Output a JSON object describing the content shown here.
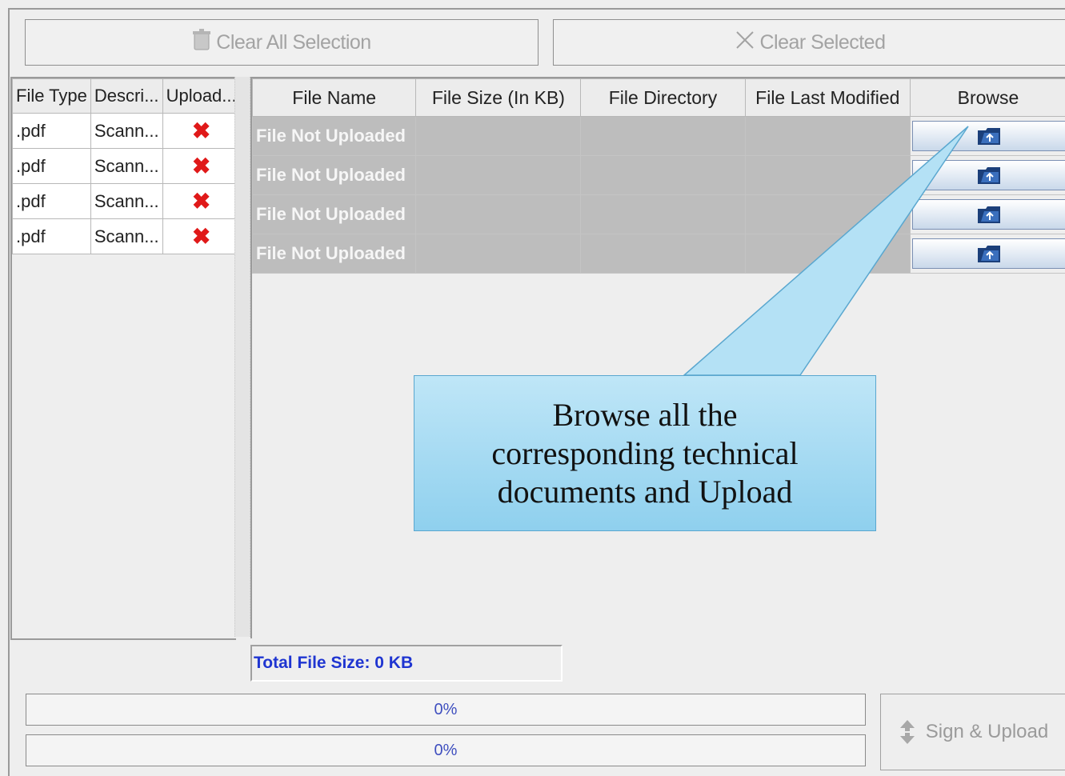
{
  "toolbar": {
    "clear_all_label": "Clear All Selection",
    "clear_selected_label": "Clear Selected"
  },
  "file_types_table": {
    "headers": [
      "File Type",
      "Descri...",
      "Upload..."
    ],
    "rows": [
      {
        "type": ".pdf",
        "description": "Scann..."
      },
      {
        "type": ".pdf",
        "description": "Scann..."
      },
      {
        "type": ".pdf",
        "description": "Scann..."
      },
      {
        "type": ".pdf",
        "description": "Scann..."
      }
    ]
  },
  "files_table": {
    "headers": [
      "File Name",
      "File Size (In KB)",
      "File Directory",
      "File Last Modified",
      "Browse"
    ],
    "rows": [
      {
        "name": "File Not Uploaded"
      },
      {
        "name": "File Not Uploaded"
      },
      {
        "name": "File Not Uploaded"
      },
      {
        "name": "File Not Uploaded"
      }
    ]
  },
  "total_size_label": "Total File Size: 0 KB",
  "progress": [
    {
      "label": "0%",
      "value": 0
    },
    {
      "label": "0%",
      "value": 0
    }
  ],
  "sign_upload_label": "Sign & Upload",
  "callout_text": "Browse all the corresponding technical documents and Upload",
  "colors": {
    "accent_blue": "#1f35d1",
    "error_red": "#e01919",
    "callout": "#a6dcf2"
  }
}
